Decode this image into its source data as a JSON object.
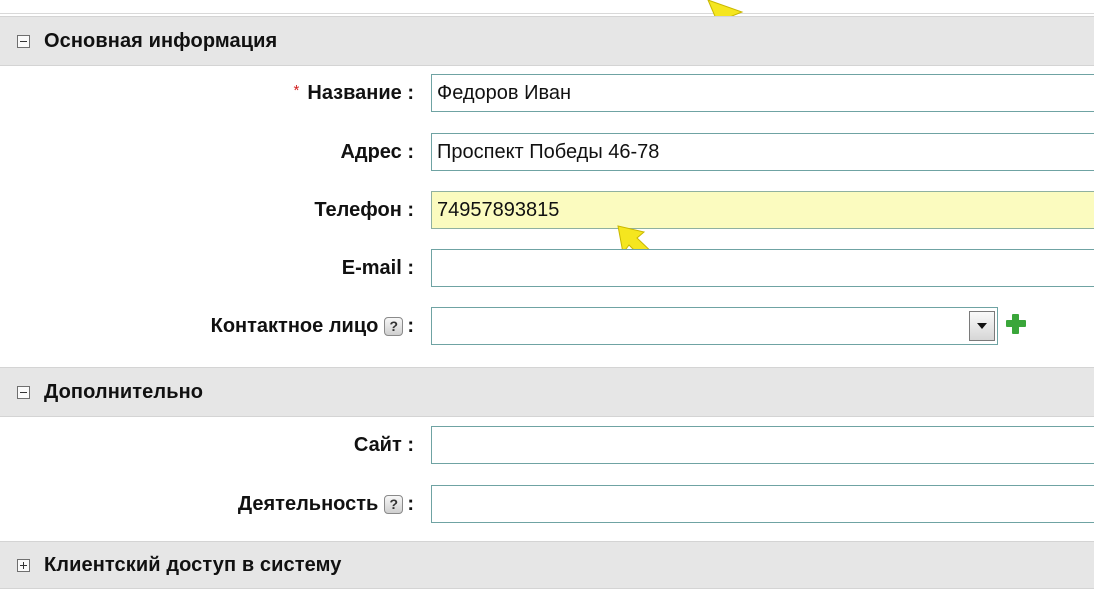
{
  "sections": {
    "main": {
      "title": "Основная информация"
    },
    "extra": {
      "title": "Дополнительно"
    },
    "access": {
      "title": "Клиентский доступ в систему"
    }
  },
  "fields": {
    "name": {
      "required_mark": "*",
      "label": "Название :",
      "value": "Федоров Иван"
    },
    "address": {
      "label": "Адрес :",
      "value": "Проспект Победы 46-78"
    },
    "phone": {
      "label": "Телефон :",
      "value": "74957893815"
    },
    "email": {
      "label": "E-mail :",
      "value": ""
    },
    "contact": {
      "label": "Контактное лицо",
      "help": "?",
      "colon": ":",
      "value": ""
    },
    "site": {
      "label": "Сайт :",
      "value": ""
    },
    "activity": {
      "label": "Деятельность",
      "help": "?",
      "colon": ":",
      "value": ""
    }
  },
  "colors": {
    "highlight_field": "#fbfbbf",
    "section_bg": "#e6e6e6",
    "arrow_yellow": "#f5e61f",
    "add_green": "#3aa63a"
  }
}
